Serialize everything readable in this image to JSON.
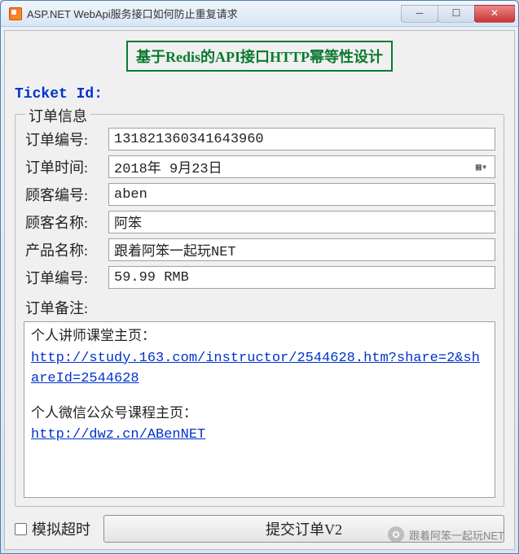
{
  "window": {
    "title": "ASP.NET WebApi服务接口如何防止重复请求"
  },
  "header_banner": "基于Redis的API接口HTTP幂等性设计",
  "ticket_id_label": "Ticket Id:",
  "groupbox_legend": "订单信息",
  "fields": {
    "order_no": {
      "label": "订单编号:",
      "value": "131821360341643960"
    },
    "order_time": {
      "label": "订单时间:",
      "value": "2018年 9月23日"
    },
    "customer_no": {
      "label": "顾客编号:",
      "value": "aben"
    },
    "customer_name": {
      "label": "顾客名称:",
      "value": "阿笨"
    },
    "product_name": {
      "label": "产品名称:",
      "value": "跟着阿笨一起玩NET"
    },
    "price": {
      "label": "订单编号:",
      "value": "59.99 RMB"
    }
  },
  "remarks": {
    "label": "订单备注:",
    "line1": "个人讲师课堂主页：",
    "link1": "http://study.163.com/instructor/2544628.htm?share=2&shareId=2544628",
    "line2": "个人微信公众号课程主页：",
    "link2": "http://dwz.cn/ABenNET"
  },
  "bottom": {
    "timeout_checkbox": "模拟超时",
    "submit_button": "提交订单V2"
  },
  "watermark": "跟着阿笨一起玩NET",
  "win_controls": {
    "minimize": "─",
    "maximize": "☐",
    "close": "✕"
  }
}
